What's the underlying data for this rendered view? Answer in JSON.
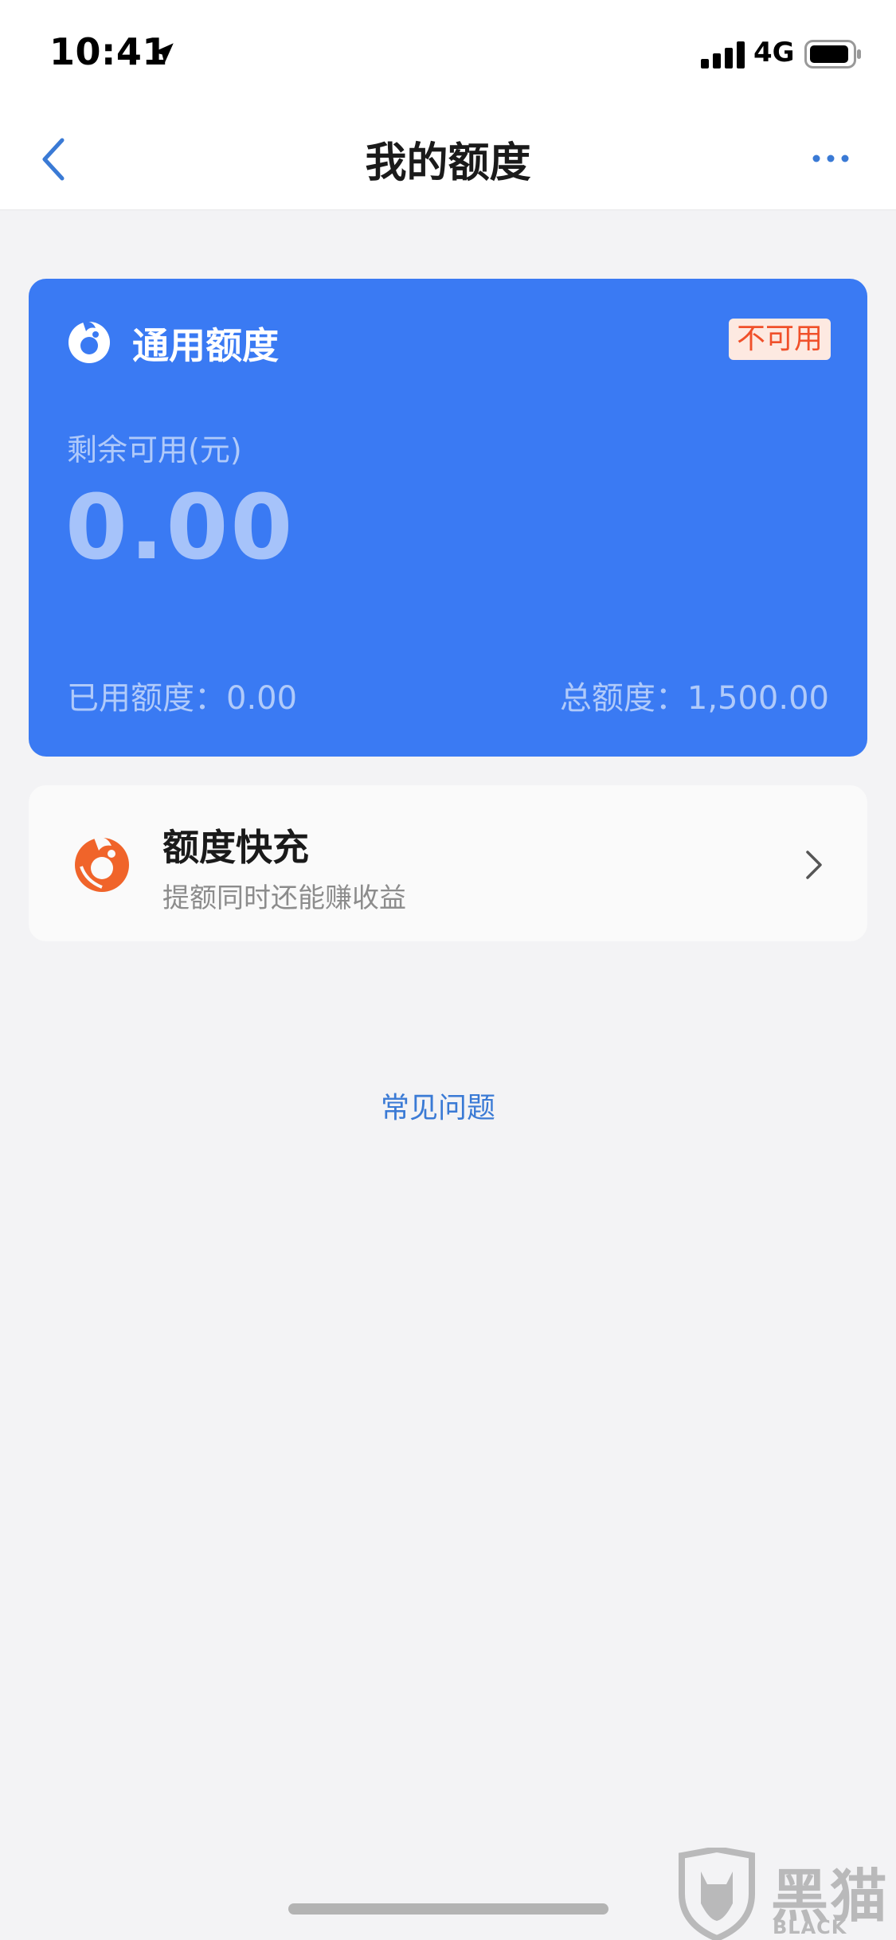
{
  "status_bar": {
    "time": "10:41",
    "network": "4G",
    "icons": [
      "location-arrow-icon",
      "signal-icon",
      "battery-icon"
    ]
  },
  "nav": {
    "title": "我的额度",
    "icons": [
      "back-icon",
      "more-icon"
    ]
  },
  "credit_card": {
    "title": "通用额度",
    "status_badge": "不可用",
    "remaining_label": "剩余可用(元)",
    "remaining_amount": "0.00",
    "used_text": "已用额度：0.00",
    "total_text": "总额度：1,500.00",
    "colors": {
      "card_bg": "#3a7af3",
      "badge_text": "#f0502a",
      "badge_bg": "#fde9e1"
    }
  },
  "quick_recharge": {
    "title": "额度快充",
    "subtitle": "提额同时还能赚收益",
    "icon": "quick-recharge-icon",
    "accent": "#f0642a"
  },
  "faq": {
    "label": "常见问题",
    "color": "#3a7ad5"
  },
  "watermark": {
    "cn": "黑猫",
    "en": "BLACK CAT"
  }
}
